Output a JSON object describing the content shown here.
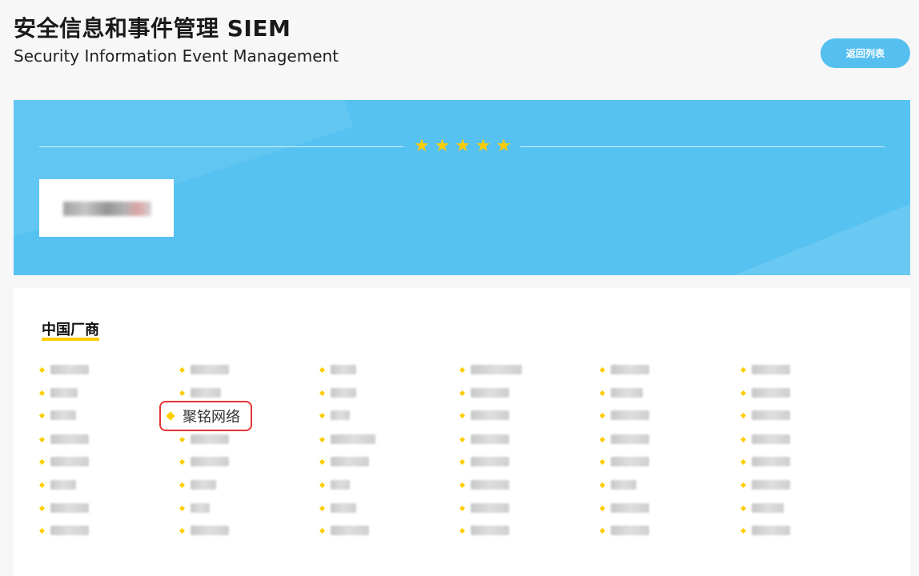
{
  "header": {
    "title_zh": "安全信息和事件管理 SIEM",
    "title_en": "Security Information Event Management",
    "back_button": "返回列表"
  },
  "banner": {
    "rating": 5,
    "star_icon": "star-icon"
  },
  "section": {
    "title": "中国厂商",
    "accent_color": "#ffcc00",
    "highlighted_vendor": "聚铭网络"
  },
  "colors": {
    "banner": "#56c2f1",
    "button": "#55c0f0",
    "highlight_border": "#e53333"
  }
}
